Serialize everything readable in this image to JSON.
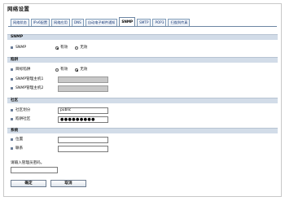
{
  "page_title": "网络设置",
  "tabs": [
    {
      "label": "网络状态",
      "active": false
    },
    {
      "label": "IPv6配置",
      "active": false
    },
    {
      "label": "网络应用",
      "active": false
    },
    {
      "label": "DNS",
      "active": false
    },
    {
      "label": "自动电子邮件通知",
      "active": false
    },
    {
      "label": "SNMP",
      "active": true
    },
    {
      "label": "SMTP",
      "active": false
    },
    {
      "label": "POP3",
      "active": false
    },
    {
      "label": "扫描到传真",
      "active": false
    }
  ],
  "sections": {
    "snmp": {
      "title": "SNMP",
      "rows": {
        "snmp": {
          "label": "SNMP",
          "options": [
            "有效",
            "无效"
          ],
          "selected": "有效"
        }
      }
    },
    "trap": {
      "title": "陷阱",
      "rows": {
        "trap": {
          "label": "目标陷阱",
          "options": [
            "有效",
            "无效"
          ],
          "selected": "无效"
        },
        "host1": {
          "label": "SNMP管理主机1",
          "value": ""
        },
        "host2": {
          "label": "SNMP管理主机2",
          "value": ""
        }
      }
    },
    "community": {
      "title": "社区",
      "rows": {
        "community_name": {
          "label": "社区划分",
          "value": "public"
        },
        "trap_community": {
          "label": "陷阱社区",
          "value": "●●●●●●●●●"
        }
      }
    },
    "system": {
      "title": "系统",
      "rows": {
        "location": {
          "label": "位置",
          "value": ""
        },
        "contact": {
          "label": "联系",
          "value": ""
        }
      }
    }
  },
  "admin": {
    "prompt": "请输入管理员密码。",
    "value": ""
  },
  "buttons": {
    "ok": "确定",
    "cancel": "取消"
  },
  "colors": {
    "section_bar": "#d2dce8",
    "tab_border": "#6d86a3",
    "bullet": "#6a7d99",
    "disabled_field": "#c8c8c8"
  }
}
